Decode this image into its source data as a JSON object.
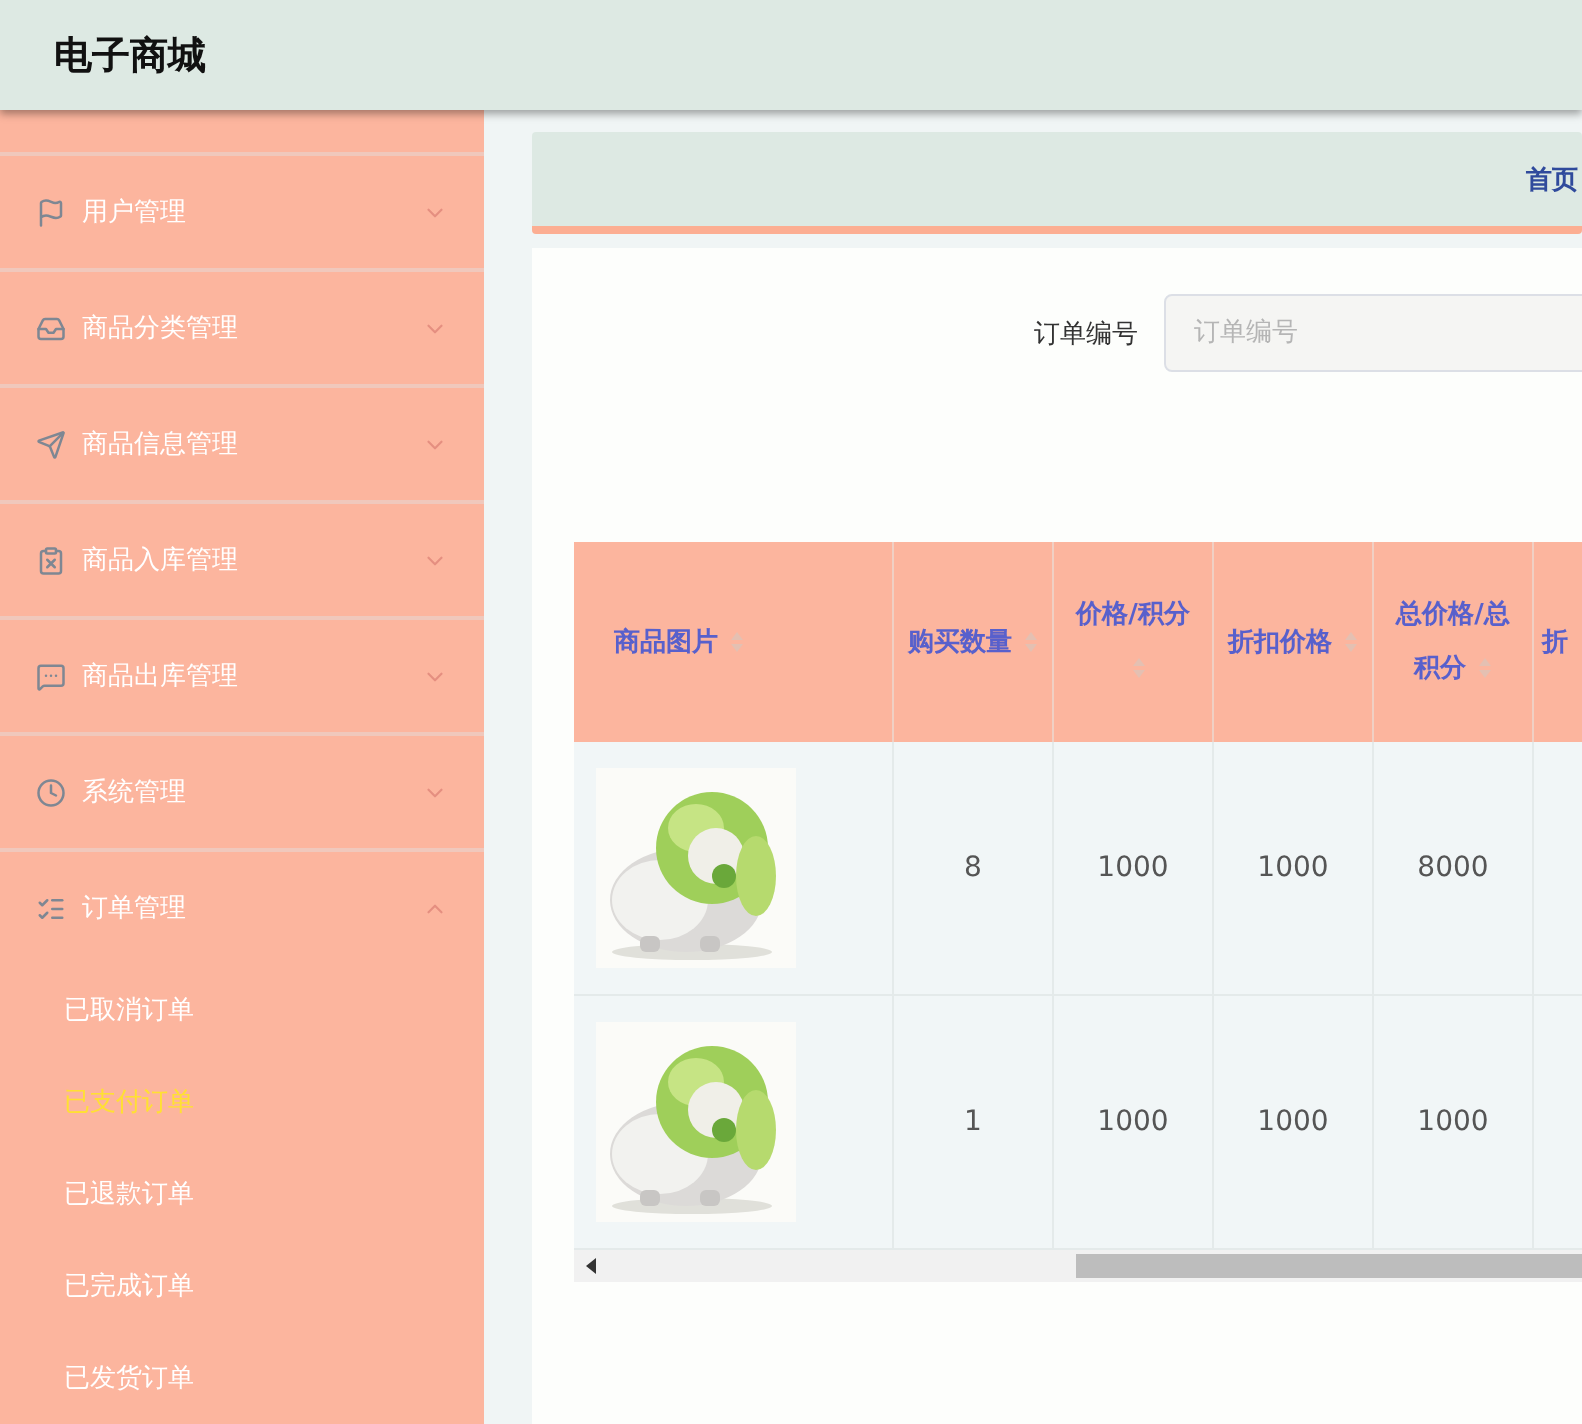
{
  "header": {
    "title": "电子商城"
  },
  "sidebar": {
    "items": [
      {
        "label": "用户管理",
        "expanded": false
      },
      {
        "label": "商品分类管理",
        "expanded": false
      },
      {
        "label": "商品信息管理",
        "expanded": false
      },
      {
        "label": "商品入库管理",
        "expanded": false
      },
      {
        "label": "商品出库管理",
        "expanded": false
      },
      {
        "label": "系统管理",
        "expanded": false
      },
      {
        "label": "订单管理",
        "expanded": true,
        "children": [
          {
            "label": "已取消订单",
            "selected": false
          },
          {
            "label": "已支付订单",
            "selected": true
          },
          {
            "label": "已退款订单",
            "selected": false
          },
          {
            "label": "已完成订单",
            "selected": false
          },
          {
            "label": "已发货订单",
            "selected": false
          }
        ]
      }
    ]
  },
  "breadcrumb": {
    "items": [
      "首页"
    ]
  },
  "search": {
    "label": "订单编号",
    "placeholder": "订单编号"
  },
  "table": {
    "columns": [
      {
        "label": "商品图片",
        "sortable": true
      },
      {
        "label": "购买数量",
        "sortable": true
      },
      {
        "label": "价格/积分",
        "sortable": true
      },
      {
        "label": "折扣价格",
        "sortable": true
      },
      {
        "label": "总价格/总积分",
        "sortable": true
      },
      {
        "label": "折",
        "sortable": false
      }
    ],
    "rows": [
      {
        "cells": [
          {
            "kind": "picture"
          },
          "8",
          "1000",
          "1000",
          "8000"
        ]
      },
      {
        "cells": [
          {
            "kind": "picture"
          },
          "1",
          "1000",
          "1000",
          "1000"
        ]
      }
    ]
  }
}
